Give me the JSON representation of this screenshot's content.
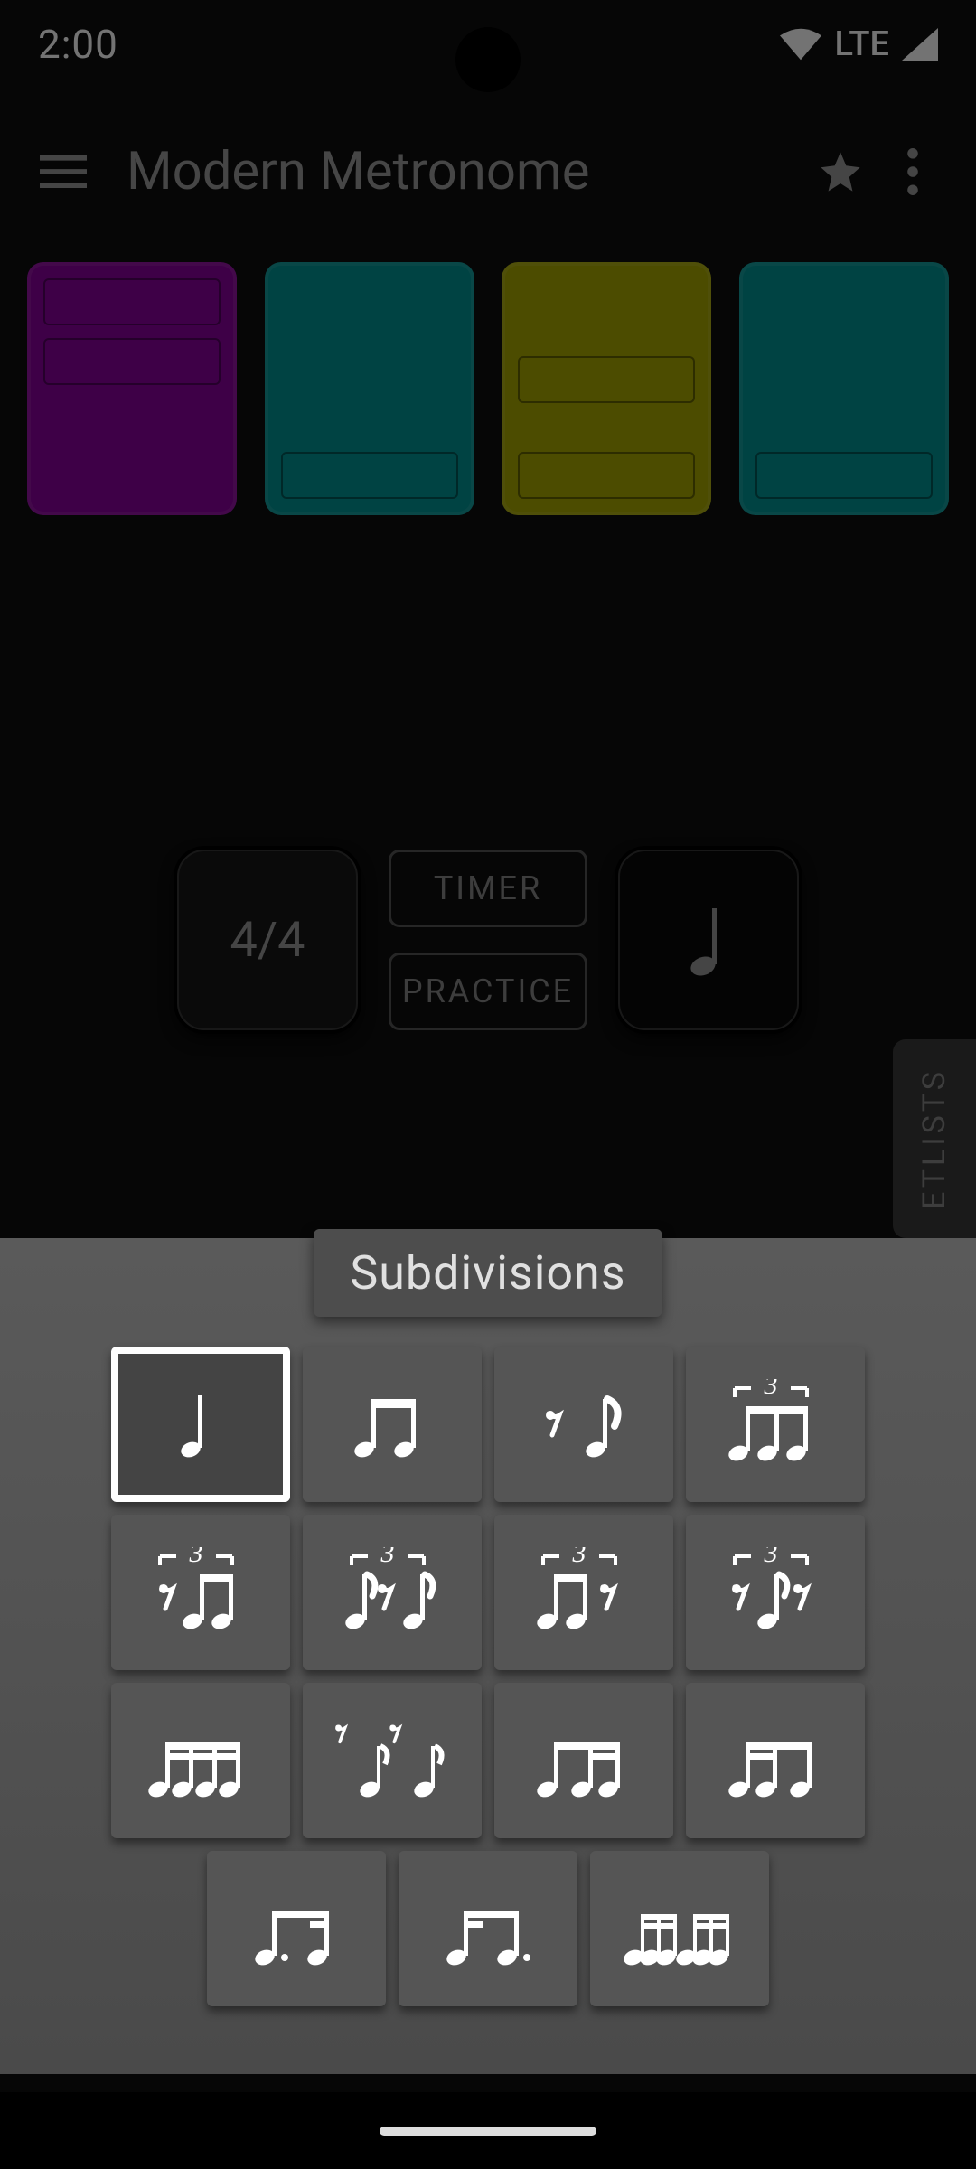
{
  "status": {
    "time": "2:00",
    "network": "LTE"
  },
  "app": {
    "title": "Modern Metronome"
  },
  "mid": {
    "time_signature": "4/4",
    "timer_label": "TIMER",
    "practice_label": "PRACTICE"
  },
  "sidetab": {
    "label": "ETLISTS"
  },
  "sheet": {
    "title": "Subdivisions",
    "items": [
      {
        "id": "quarter",
        "selected": true
      },
      {
        "id": "two-eighths",
        "selected": false
      },
      {
        "id": "rest-eighth",
        "selected": false
      },
      {
        "id": "triplet",
        "selected": false
      },
      {
        "id": "triplet-rest-first",
        "selected": false
      },
      {
        "id": "triplet-rest-mid",
        "selected": false
      },
      {
        "id": "triplet-rest-last",
        "selected": false
      },
      {
        "id": "triplet-outer-rest",
        "selected": false
      },
      {
        "id": "four-sixteenths",
        "selected": false
      },
      {
        "id": "rest-pair-rest-pair",
        "selected": false
      },
      {
        "id": "eighth-two-16",
        "selected": false
      },
      {
        "id": "two-16-eighth",
        "selected": false
      },
      {
        "id": "dot8-16",
        "selected": false
      },
      {
        "id": "16-dot8",
        "selected": false
      },
      {
        "id": "sixtuplet",
        "selected": false
      }
    ]
  }
}
